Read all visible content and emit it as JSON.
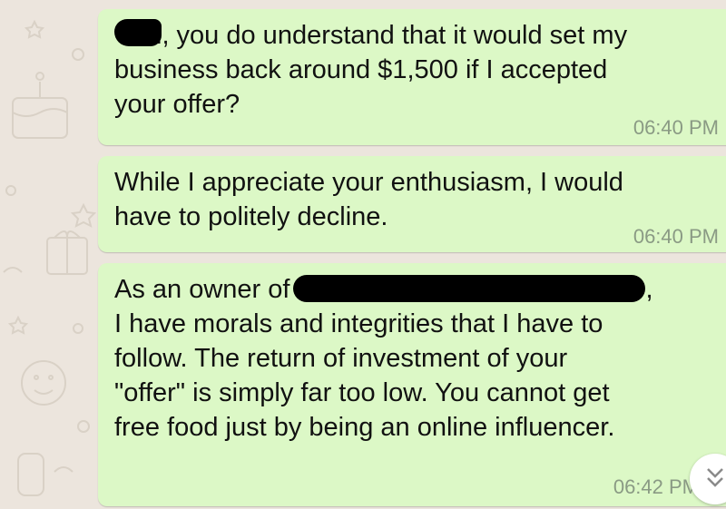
{
  "messages": [
    {
      "lines": [
        "l, you do understand that it would set my",
        "business back around $1,500 if I accepted",
        "your offer?"
      ],
      "time": "06:40 PM"
    },
    {
      "lines": [
        "While I appreciate your enthusiasm, I would",
        "have to politely decline."
      ],
      "time": "06:40 PM"
    },
    {
      "lines": [
        "As an owner of",
        ",",
        "I have morals and integrities that I have to",
        "follow. The return of investment of your",
        "\"offer\" is simply far too low. You cannot get",
        "free food just by being an online influencer."
      ],
      "time": "06:42 PM"
    }
  ],
  "icons": {
    "read_receipt": "double-check-icon",
    "scroll_down": "chevron-double-down-icon",
    "wallpaper": "doodle-pattern"
  },
  "colors": {
    "background": "#ece5dd",
    "bubble": "#dcf8c6",
    "tick": "#4fc3f7",
    "timestamp": "#8a9a84"
  }
}
